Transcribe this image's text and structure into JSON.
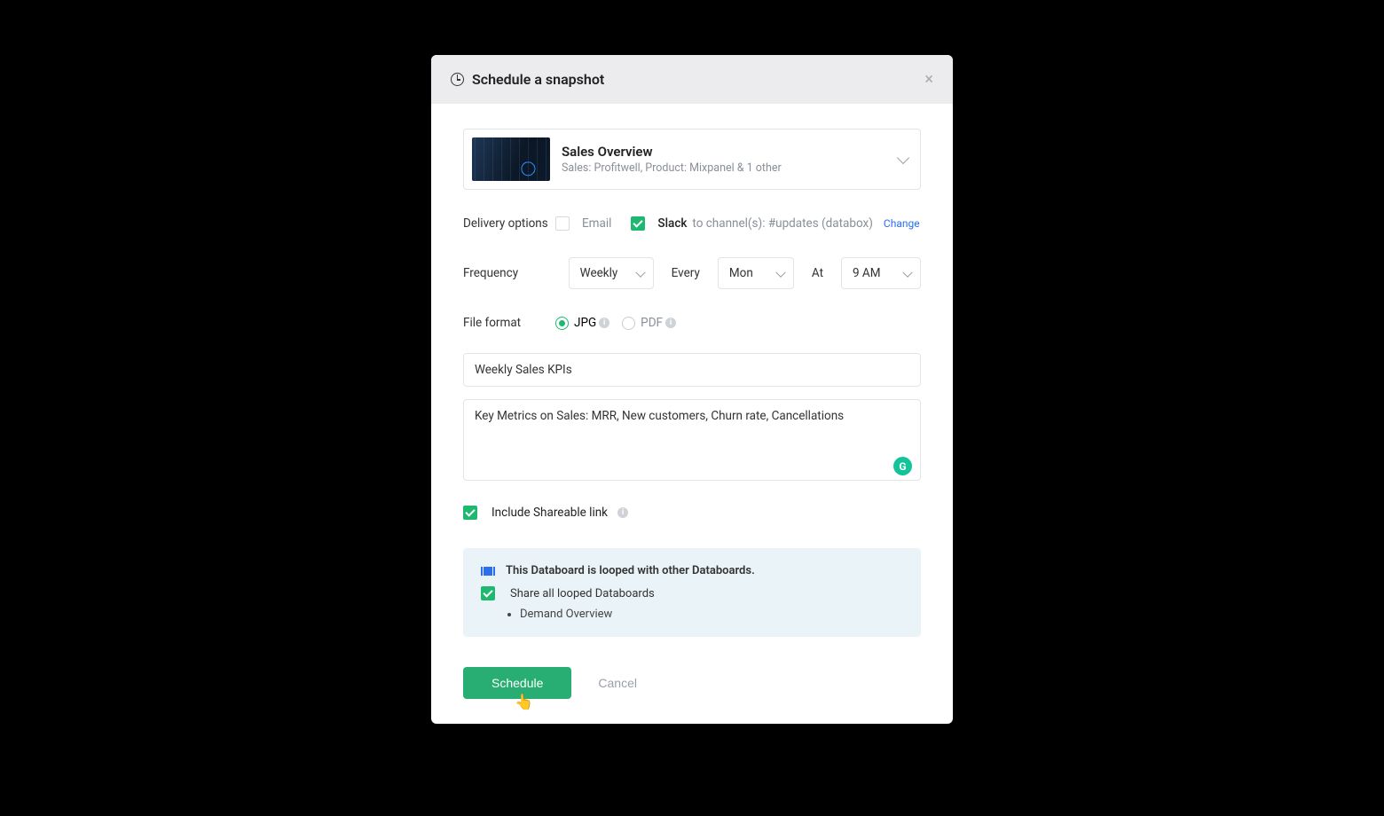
{
  "modal": {
    "title": "Schedule a snapshot"
  },
  "databoard": {
    "name": "Sales Overview",
    "subtitle": "Sales: Profitwell, Product: Mixpanel & 1 other"
  },
  "delivery": {
    "label": "Delivery options",
    "email": {
      "label": "Email",
      "checked": false
    },
    "slack": {
      "checked": true,
      "label": "Slack",
      "suffix": "to channel(s): #updates (databox)",
      "change_link": "Change"
    }
  },
  "frequency": {
    "label": "Frequency",
    "period": "Weekly",
    "every_label": "Every",
    "day": "Mon",
    "at_label": "At",
    "time": "9 AM"
  },
  "format": {
    "label": "File format",
    "jpg": "JPG",
    "pdf": "PDF",
    "selected": "jpg"
  },
  "name_input": "Weekly Sales KPIs",
  "description": "Key Metrics on Sales: MRR, New customers, Churn rate, Cancellations",
  "shareable": {
    "checked": true,
    "label": "Include Shareable link"
  },
  "loop": {
    "heading": "This Databoard is looped with other Databoards.",
    "share_all": {
      "checked": true,
      "label": "Share all looped Databoards"
    },
    "items": [
      "Demand Overview"
    ]
  },
  "actions": {
    "primary": "Schedule",
    "secondary": "Cancel"
  }
}
